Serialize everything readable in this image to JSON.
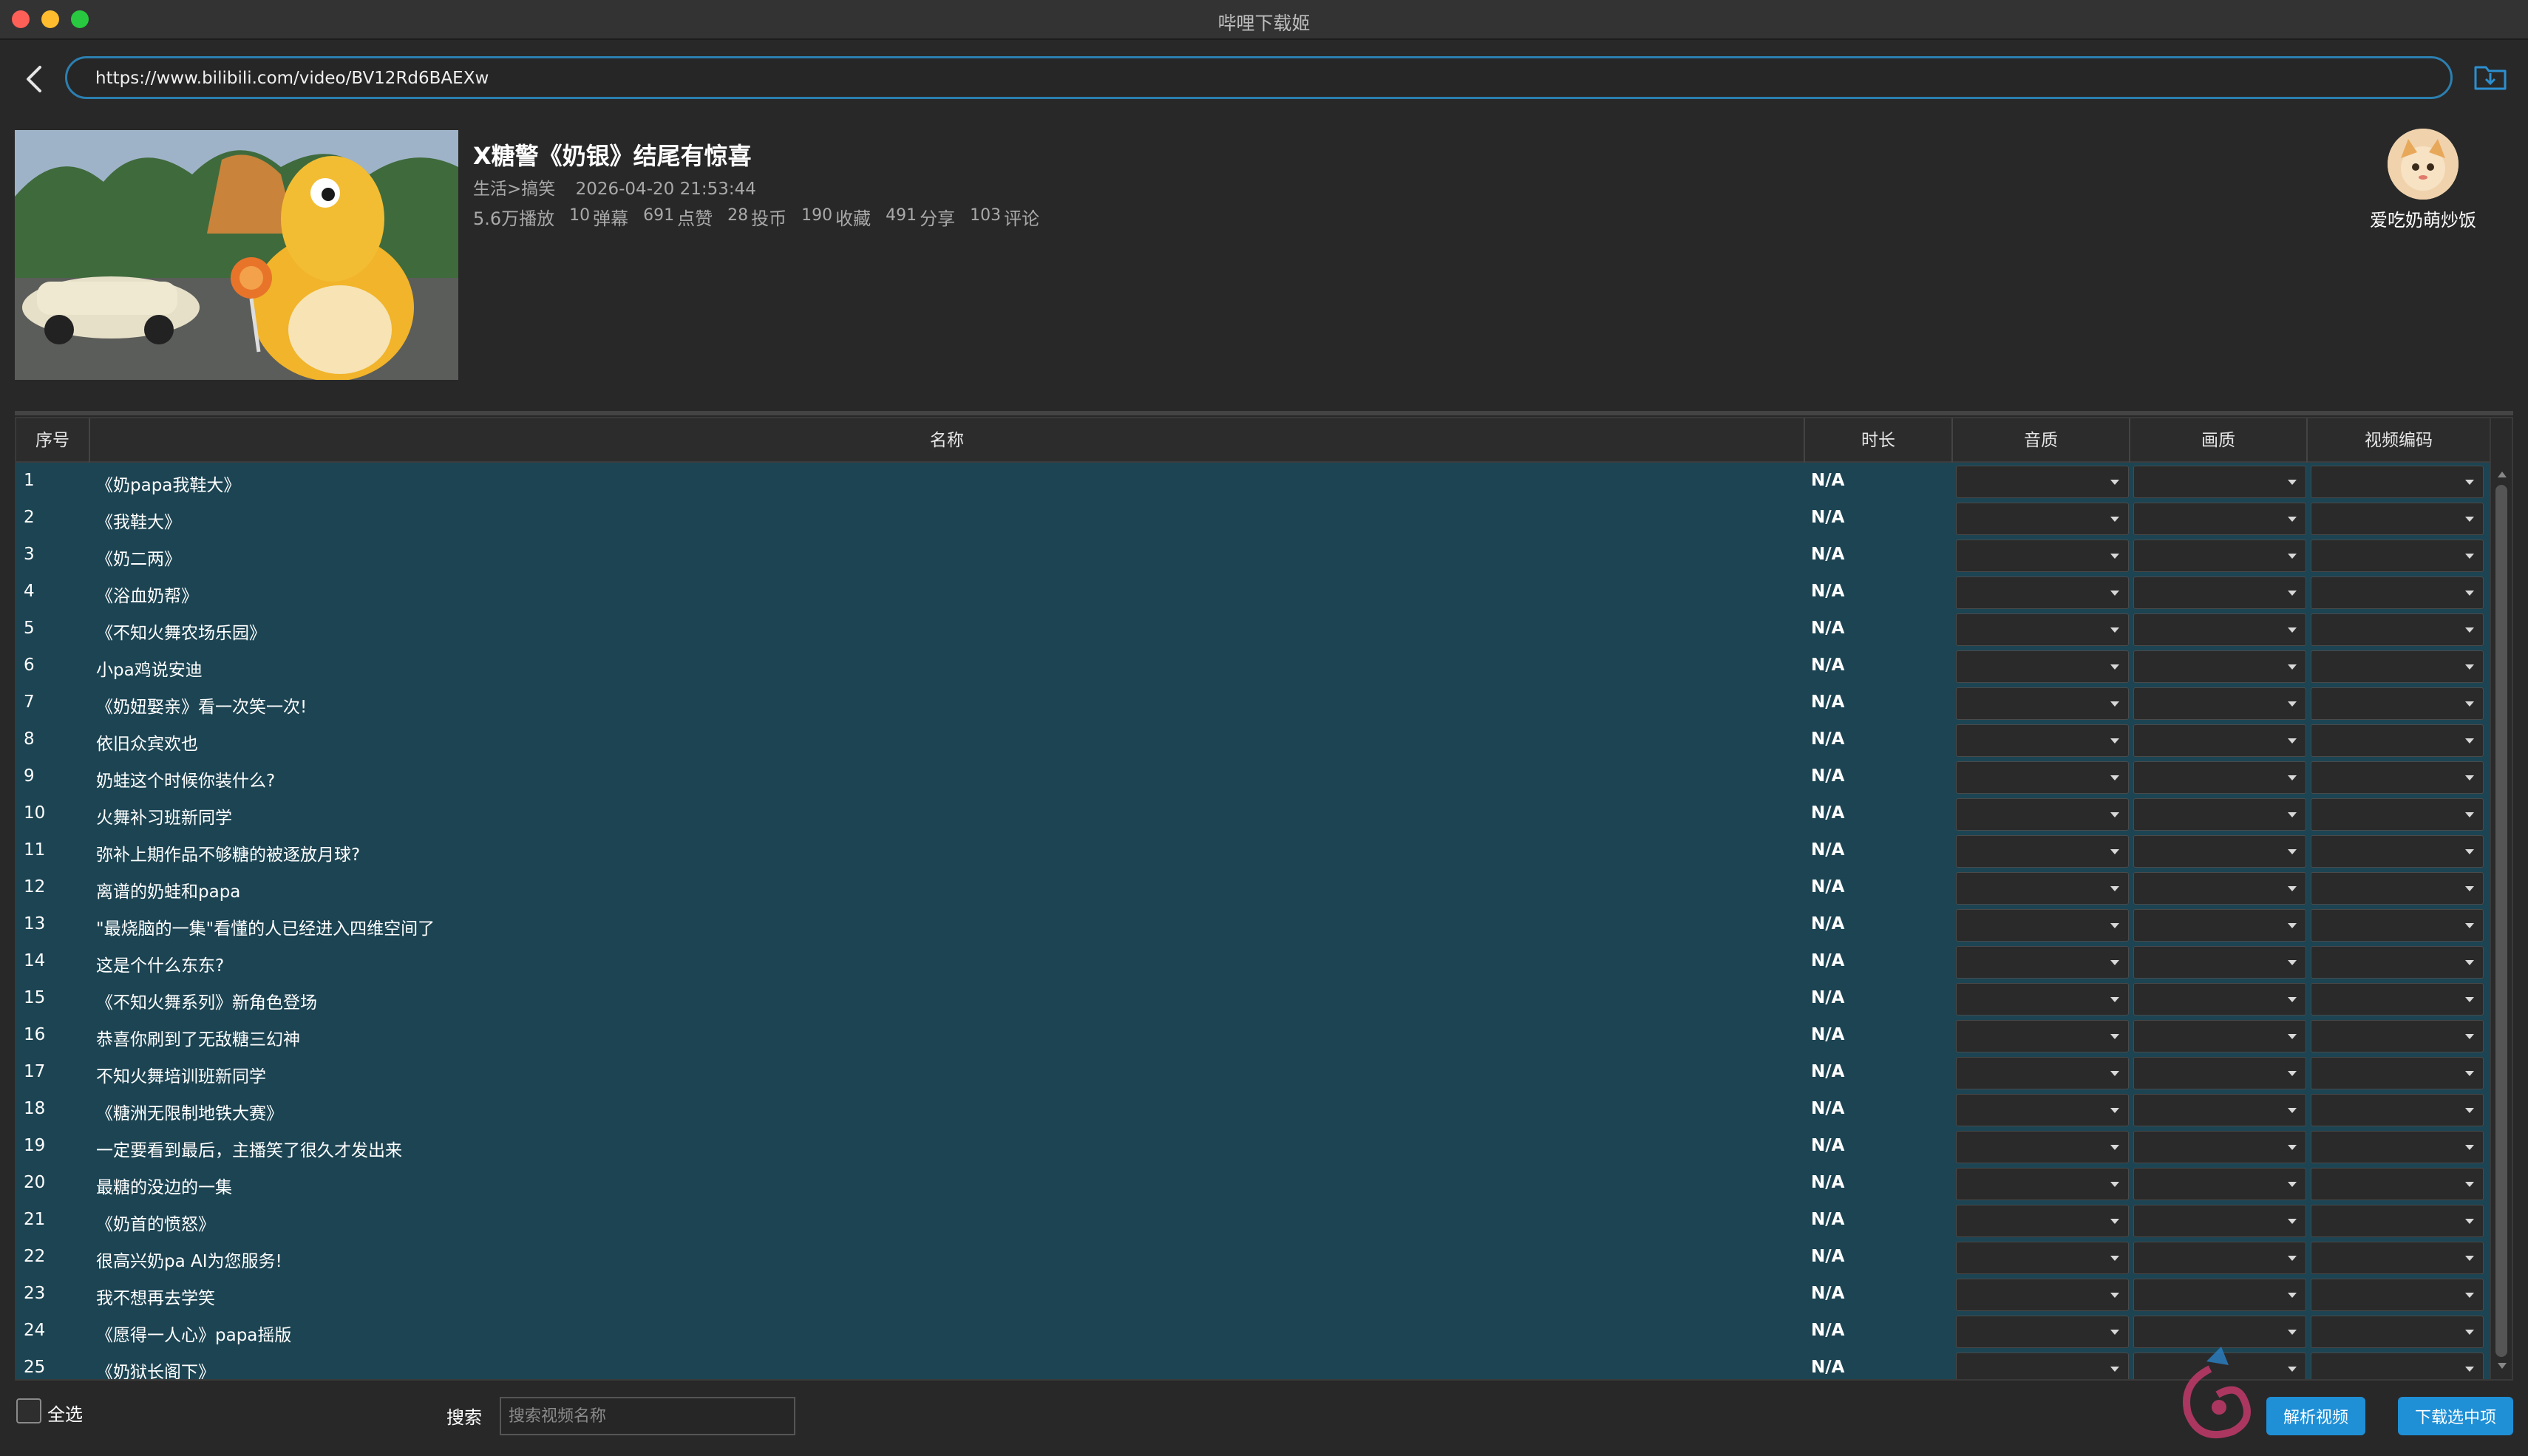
{
  "window": {
    "title": "哔哩下载姬"
  },
  "url_bar": {
    "url": "https://www.bilibili.com/video/BV12Rd6BAEXw"
  },
  "video": {
    "title": "X糖警《奶银》结尾有惊喜",
    "category": "生活>搞笑",
    "published": "2026-04-20 21:53:44",
    "stats": [
      {
        "num": "",
        "label": "5.6万播放"
      },
      {
        "num": "10",
        "label": "弹幕"
      },
      {
        "num": "691",
        "label": "点赞"
      },
      {
        "num": "28",
        "label": "投币"
      },
      {
        "num": "190",
        "label": "收藏"
      },
      {
        "num": "491",
        "label": "分享"
      },
      {
        "num": "103",
        "label": "评论"
      }
    ]
  },
  "uploader": {
    "name": "爱吃奶萌炒饭"
  },
  "table": {
    "headers": {
      "index": "序号",
      "name": "名称",
      "duration": "时长",
      "audio": "音质",
      "video_quality": "画质",
      "codec": "视频编码"
    },
    "rows": [
      {
        "index": "1",
        "name": "《奶papa我鞋大》",
        "duration": "N/A"
      },
      {
        "index": "2",
        "name": "《我鞋大》",
        "duration": "N/A"
      },
      {
        "index": "3",
        "name": "《奶二两》",
        "duration": "N/A"
      },
      {
        "index": "4",
        "name": "《浴血奶帮》",
        "duration": "N/A"
      },
      {
        "index": "5",
        "name": "《不知火舞农场乐园》",
        "duration": "N/A"
      },
      {
        "index": "6",
        "name": "小pa鸡说安迪",
        "duration": "N/A"
      },
      {
        "index": "7",
        "name": "《奶妞娶亲》看一次笑一次!",
        "duration": "N/A"
      },
      {
        "index": "8",
        "name": "依旧众宾欢也",
        "duration": "N/A"
      },
      {
        "index": "9",
        "name": "奶蛙这个时候你装什么?",
        "duration": "N/A"
      },
      {
        "index": "10",
        "name": "火舞补习班新同学",
        "duration": "N/A"
      },
      {
        "index": "11",
        "name": "弥补上期作品不够糖的被逐放月球?",
        "duration": "N/A"
      },
      {
        "index": "12",
        "name": "离谱的奶蛙和papa",
        "duration": "N/A"
      },
      {
        "index": "13",
        "name": "\"最烧脑的一集\"看懂的人已经进入四维空间了",
        "duration": "N/A"
      },
      {
        "index": "14",
        "name": "这是个什么东东?",
        "duration": "N/A"
      },
      {
        "index": "15",
        "name": "《不知火舞系列》新角色登场",
        "duration": "N/A"
      },
      {
        "index": "16",
        "name": "恭喜你刷到了无敌糖三幻神",
        "duration": "N/A"
      },
      {
        "index": "17",
        "name": "不知火舞培训班新同学",
        "duration": "N/A"
      },
      {
        "index": "18",
        "name": "《糖洲无限制地铁大赛》",
        "duration": "N/A"
      },
      {
        "index": "19",
        "name": "一定要看到最后，主播笑了很久才发出来",
        "duration": "N/A"
      },
      {
        "index": "20",
        "name": "最糖的没边的一集",
        "duration": "N/A"
      },
      {
        "index": "21",
        "name": "《奶首的愤怒》",
        "duration": "N/A"
      },
      {
        "index": "22",
        "name": "很高兴奶pa AI为您服务!",
        "duration": "N/A"
      },
      {
        "index": "23",
        "name": "我不想再去学笑",
        "duration": "N/A"
      },
      {
        "index": "24",
        "name": "《愿得一人心》papa摇版",
        "duration": "N/A"
      },
      {
        "index": "25",
        "name": "《奶狱长阁下》",
        "duration": "N/A"
      }
    ]
  },
  "footer": {
    "select_all": "全选",
    "search_label": "搜索",
    "search_placeholder": "搜索视频名称",
    "parse_button": "解析视频",
    "download_button": "下载选中项"
  },
  "colors": {
    "accent": "#1f8fd6",
    "table_bg": "#1c4453",
    "url_border": "#2c7fb0"
  }
}
